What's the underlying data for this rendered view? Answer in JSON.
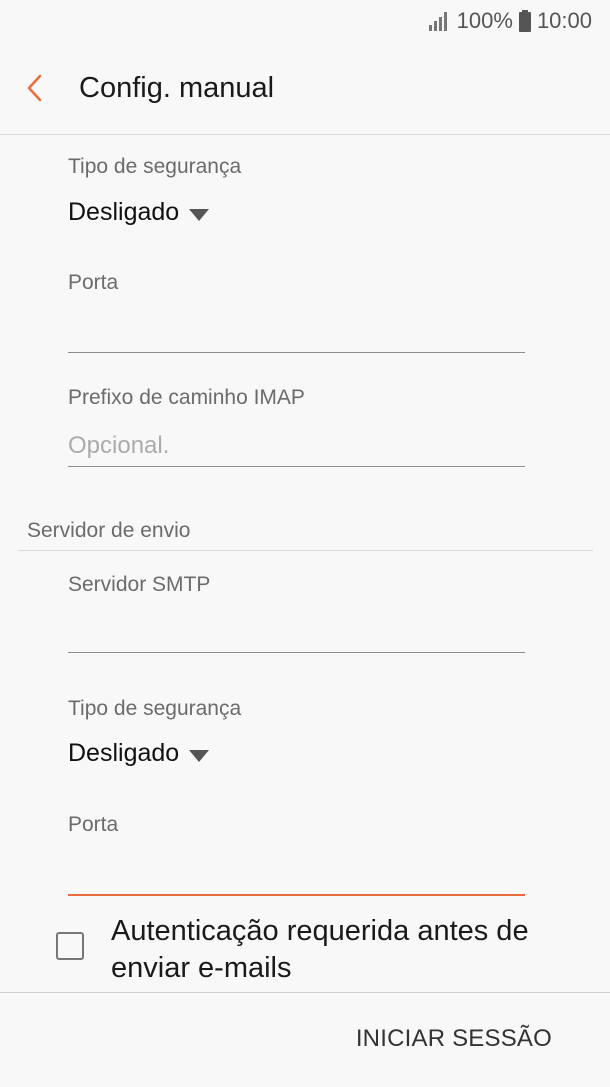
{
  "status_bar": {
    "battery_text": "100%",
    "time": "10:00",
    "signal_icon": "signal-icon",
    "battery_icon": "battery-icon"
  },
  "app_bar": {
    "title": "Config. manual",
    "back_icon": "chevron-left-icon",
    "accent_color": "#e96c3f"
  },
  "incoming": {
    "security_type_label": "Tipo de segurança",
    "security_type_value": "Desligado",
    "port_label": "Porta",
    "port_value": "",
    "imap_prefix_label": "Prefixo de caminho IMAP",
    "imap_prefix_placeholder": "Opcional."
  },
  "outgoing": {
    "section_title": "Servidor de envio",
    "smtp_label": "Servidor SMTP",
    "smtp_value": "",
    "security_type_label": "Tipo de segurança",
    "security_type_value": "Desligado",
    "port_label": "Porta",
    "port_value": ""
  },
  "auth": {
    "label": "Autenticação requerida antes de enviar e-mails",
    "checked": false
  },
  "actions": {
    "sign_in_label": "INICIAR SESSÃO"
  }
}
